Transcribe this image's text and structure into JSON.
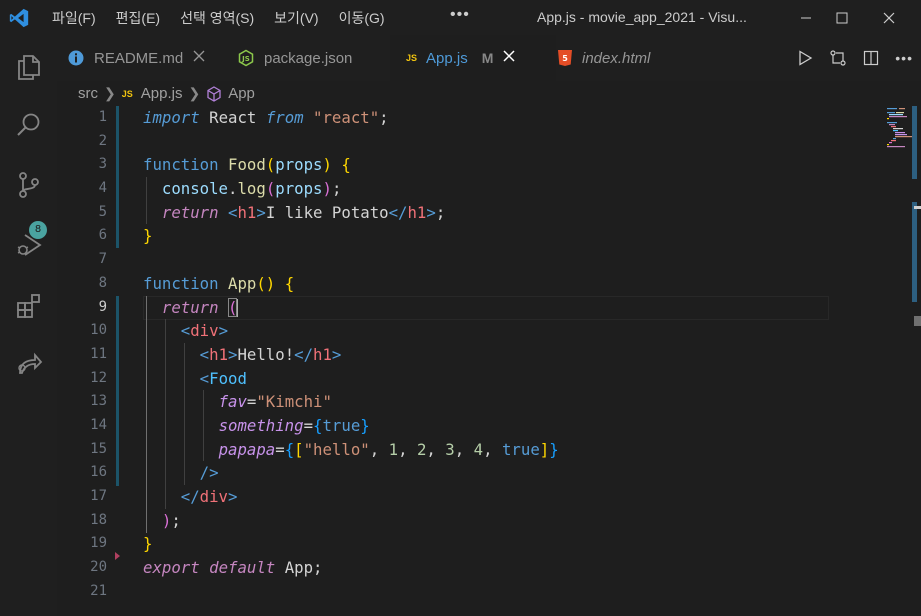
{
  "titlebar": {
    "menu": [
      "파일(F)",
      "편집(E)",
      "선택 영역(S)",
      "보기(V)",
      "이동(G)"
    ],
    "more": "•••",
    "title": "App.js - movie_app_2021 - Visu..."
  },
  "activitybar": {
    "items": [
      "explorer-icon",
      "search-icon",
      "source-control-icon",
      "run-debug-icon",
      "extensions-icon",
      "remote-icon"
    ],
    "scm_badge": "8"
  },
  "tabs": [
    {
      "label": "README.md",
      "icon": "info-icon",
      "color": "#4e9ad8",
      "active": false
    },
    {
      "label": "package.json",
      "icon": "node-icon",
      "color": "#8cc84b",
      "active": false
    },
    {
      "label": "App.js",
      "icon": "js-icon",
      "color": "#f1c40f",
      "active": true,
      "modified": "M"
    },
    {
      "label": "index.html",
      "icon": "html5-icon",
      "color": "#e44d26",
      "active": false
    }
  ],
  "breadcrumb": {
    "folder": "src",
    "file": "App.js",
    "symbol": "App",
    "file_icon_label": "JS"
  },
  "editor": {
    "current_line": 9,
    "line_numbers": [
      "1",
      "2",
      "3",
      "4",
      "5",
      "6",
      "7",
      "8",
      "9",
      "10",
      "11",
      "12",
      "13",
      "14",
      "15",
      "16",
      "17",
      "18",
      "19",
      "20",
      "21"
    ],
    "tokens": {
      "l1_import": "import",
      "l1_react": "React",
      "l1_from": "from",
      "l1_mod": "\"react\"",
      "l1_semi": ";",
      "l3_function": "function",
      "l3_name": "Food",
      "l3_props": "props",
      "l4_console": "console",
      "l4_log": "log",
      "l4_props": "props",
      "l5_return": "return",
      "l5_h1": "h1",
      "l5_text": "I like Potato",
      "l8_function": "function",
      "l8_name": "App",
      "l9_return": "return",
      "div": "div",
      "h1": "h1",
      "hello_text": "Hello!",
      "food": "Food",
      "fav": "fav",
      "fav_val": "\"Kimchi\"",
      "something": "something",
      "true": "true",
      "papapa": "papapa",
      "papapa_str": "\"hello\"",
      "n1": "1",
      "n2": "2",
      "n3": "3",
      "n4": "4",
      "l20_export": "export",
      "l20_default": "default",
      "l20_app": "App"
    }
  },
  "colors": {
    "keyword": "#569cd6",
    "control": "#c586c0",
    "function": "#dcdcaa",
    "string": "#ce9178",
    "tag": "#f07178",
    "accent": "#4e9ad8"
  }
}
